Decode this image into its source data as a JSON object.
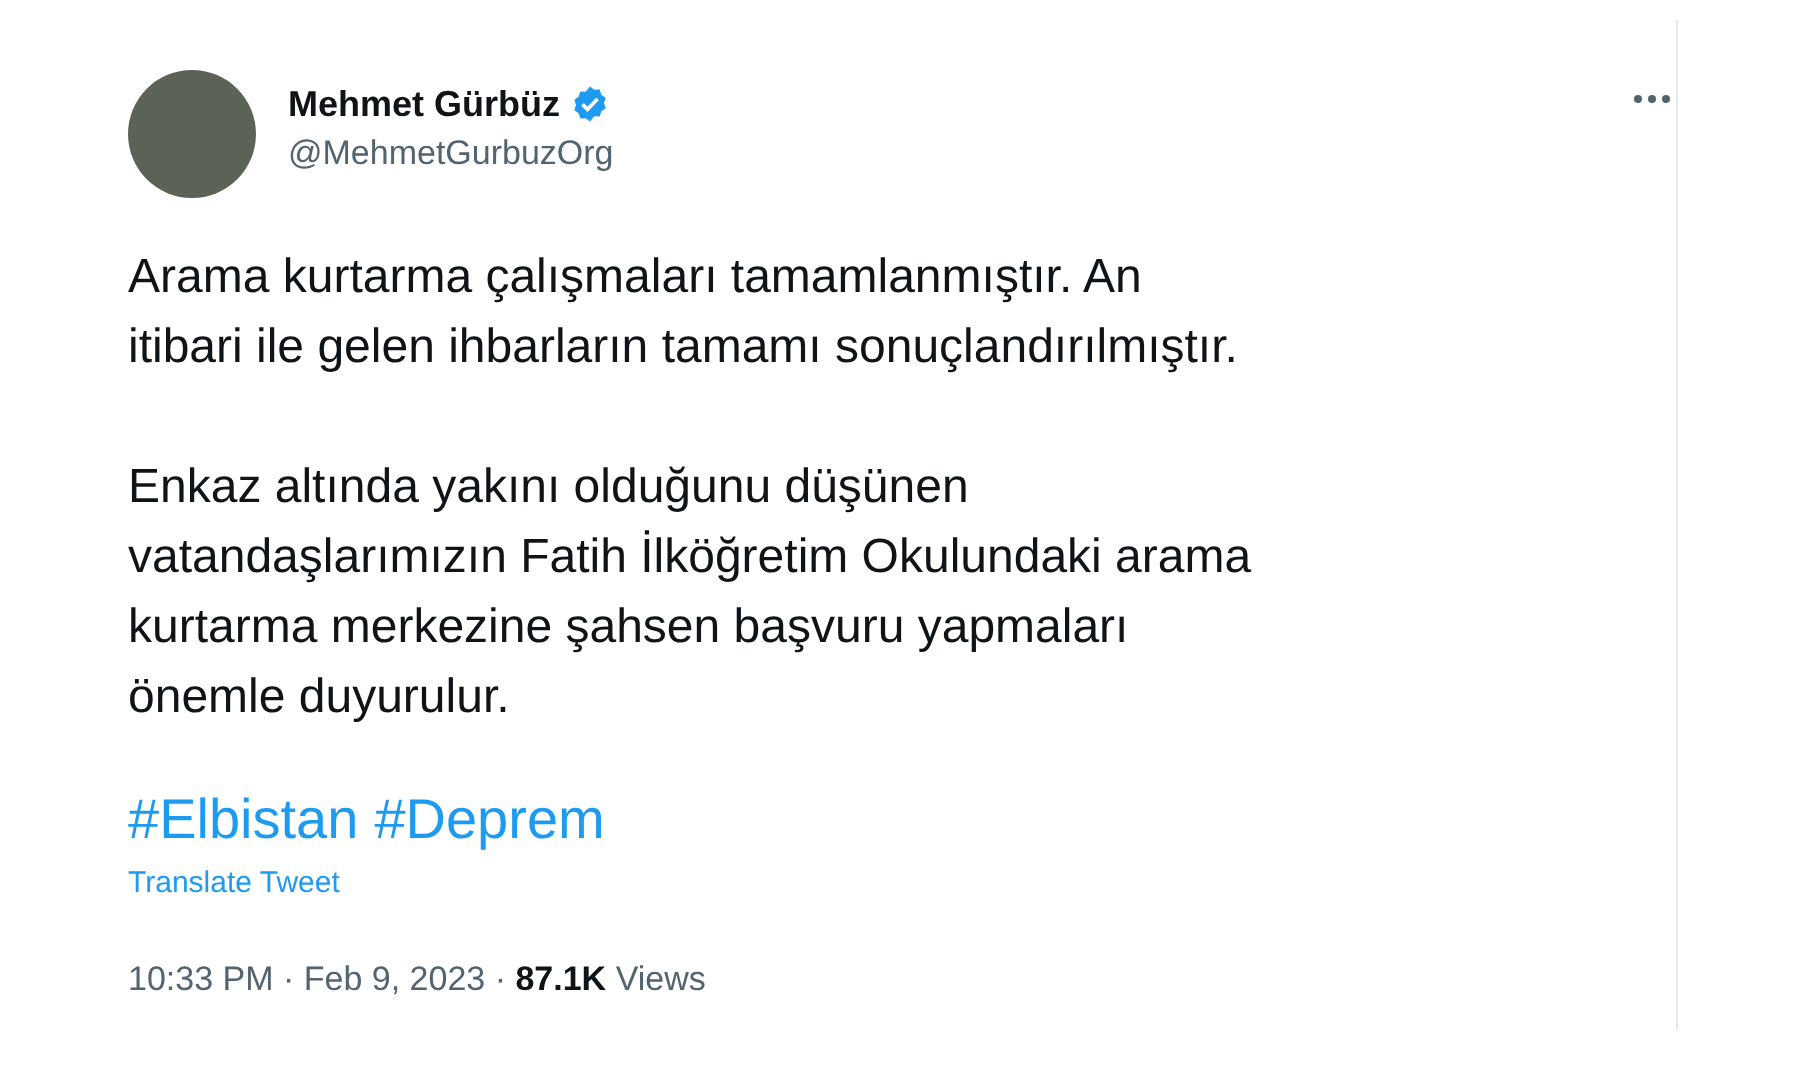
{
  "author": {
    "name": "Mehmet Gürbüz",
    "verified": true,
    "handle": "@MehmetGurbuzOrg"
  },
  "paragraphs": [
    [
      "Arama kurtarma çalışmaları tamamlanmıştır. An",
      "itibari ile gelen ihbarların tamamı sonuçlandırılmıştır."
    ],
    [
      "Enkaz altında yakını olduğunu düşünen",
      "vatandaşlarımızın Fatih İlköğretim Okulundaki arama",
      "kurtarma merkezine şahsen başvuru yapmaları",
      "önemle duyurulur."
    ]
  ],
  "hashtags": [
    "#Elbistan",
    "#Deprem"
  ],
  "translate": "Translate Tweet",
  "meta": "10:33 PM · Feb 9, 2023 · **87.1K** Views"
}
